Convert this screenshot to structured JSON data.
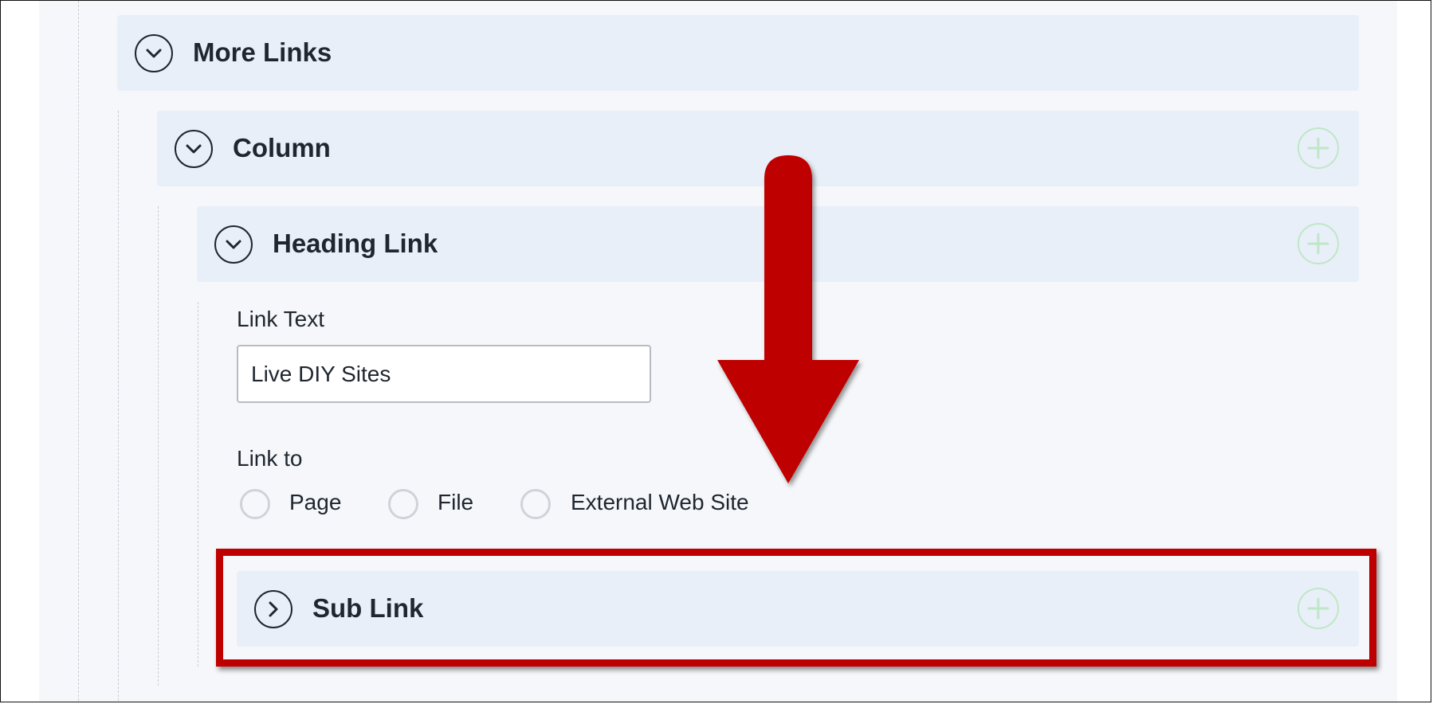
{
  "sections": {
    "more_links": {
      "title": "More Links"
    },
    "column": {
      "title": "Column"
    },
    "heading_link": {
      "title": "Heading Link"
    },
    "sub_link": {
      "title": "Sub Link"
    }
  },
  "form": {
    "link_text": {
      "label": "Link Text",
      "value": "Live DIY Sites"
    },
    "link_to": {
      "label": "Link to",
      "options": [
        "Page",
        "File",
        "External Web Site"
      ],
      "selected": null
    }
  },
  "icons": {
    "expanded": "chevron-down-icon",
    "collapsed": "chevron-right-icon",
    "add": "plus-icon"
  },
  "colors": {
    "section_bar": "#e8eff8",
    "panel": "#f5f7fa",
    "add_icon": "#bfe7c6",
    "annotation": "#bf0000"
  }
}
